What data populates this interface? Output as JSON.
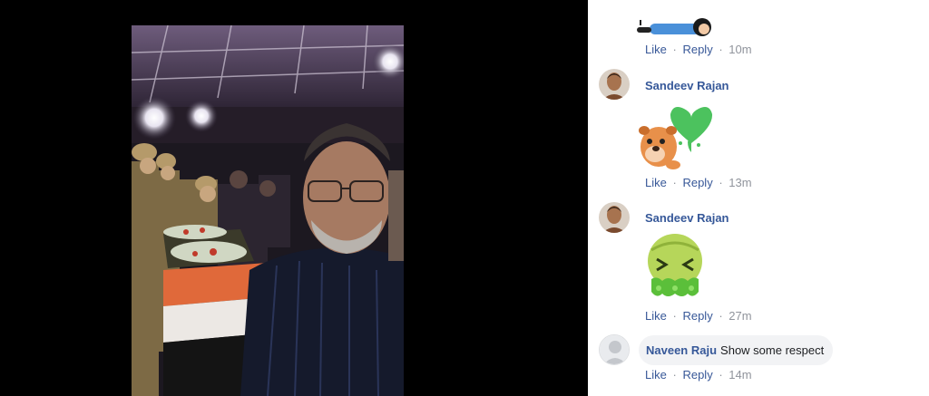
{
  "comments": [
    {
      "sticker": "lying-person-sticker",
      "actions": {
        "like": "Like",
        "reply": "Reply",
        "time": "10m"
      }
    },
    {
      "author": "Sandeev Rajan",
      "avatar": "user-avatar-photo",
      "sticker": "bear-with-heart-sticker",
      "actions": {
        "like": "Like",
        "reply": "Reply",
        "time": "13m"
      }
    },
    {
      "author": "Sandeev Rajan",
      "avatar": "user-avatar-photo",
      "sticker": "vomiting-face-sticker",
      "actions": {
        "like": "Like",
        "reply": "Reply",
        "time": "27m"
      }
    },
    {
      "author": "Naveen Raju",
      "avatar": "default-avatar-icon",
      "text": "Show some respect",
      "actions": {
        "like": "Like",
        "reply": "Reply",
        "time": "14m"
      }
    }
  ],
  "separator": "·",
  "colors": {
    "link": "#385898",
    "author": "#365899",
    "bubble": "#f2f3f5",
    "viewer_bg": "#000000",
    "muted": "#90949c"
  }
}
